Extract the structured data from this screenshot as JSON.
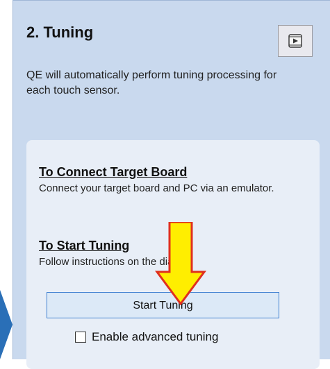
{
  "header": {
    "title": "2. Tuning",
    "video_icon": "video-play-icon"
  },
  "description": "QE will automatically perform tuning processing for each touch sensor.",
  "connect": {
    "title": "To Connect Target Board",
    "text": "Connect your target board and PC via an emulator."
  },
  "start": {
    "title": "To Start Tuning",
    "text": "Follow instructions on the dialog."
  },
  "buttons": {
    "start_tuning": "Start Tuning"
  },
  "options": {
    "advanced_label": "Enable advanced tuning",
    "advanced_checked": false
  },
  "colors": {
    "panel": "#c9d9ee",
    "card": "#e8eef7",
    "highlight_arrow": "#ffee00",
    "arrow_border": "#e0301e",
    "nav_arrow": "#2a6fb7"
  }
}
